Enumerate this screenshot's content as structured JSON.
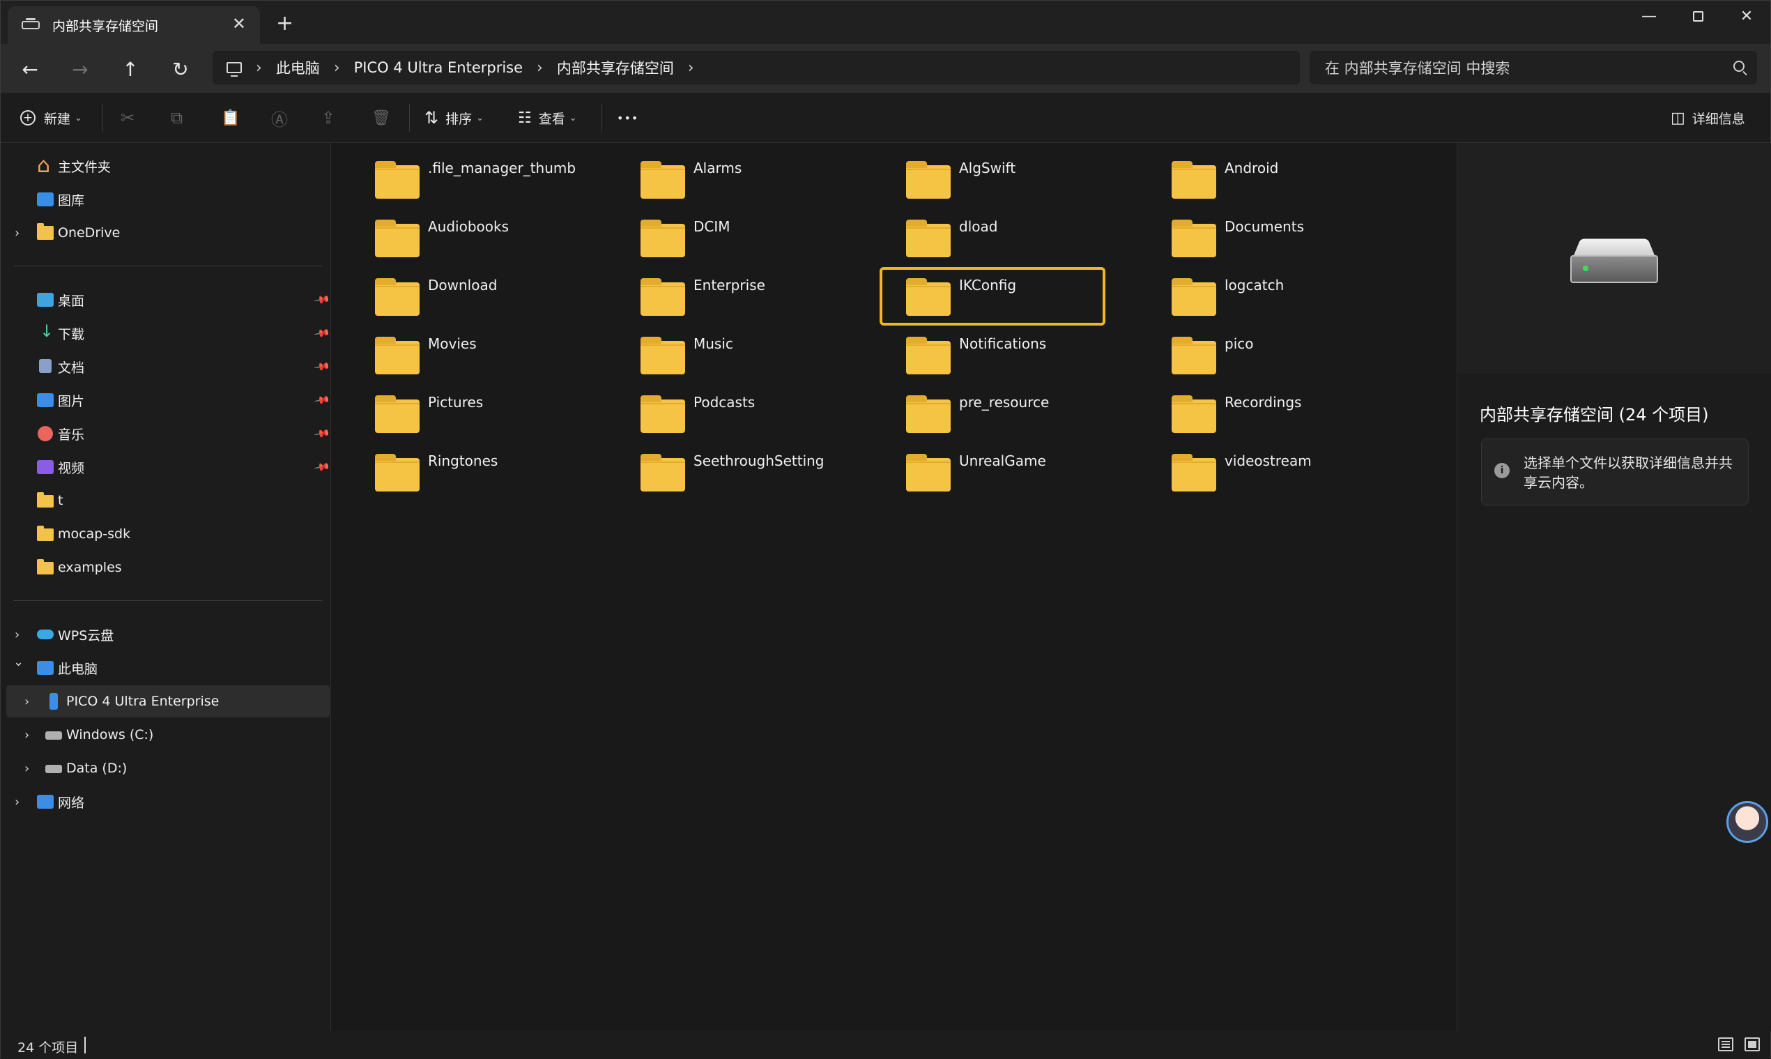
{
  "window": {
    "tab_title": "内部共享存储空间",
    "tab_close": "✕",
    "new_tab": "+",
    "min": "—",
    "close": "✕"
  },
  "nav": {
    "back": "←",
    "forward": "→",
    "up": "↑",
    "refresh": "↻",
    "breadcrumbs": [
      "此电脑",
      "PICO 4 Ultra Enterprise",
      "内部共享存储空间"
    ],
    "sep": "›",
    "search_placeholder": "在 内部共享存储空间 中搜索"
  },
  "toolbar": {
    "new_label": "新建",
    "sort_label": "排序",
    "view_label": "查看",
    "more": "•••",
    "details_label": "详细信息",
    "cut": "✂",
    "copy": "⧉",
    "paste": "📋",
    "rename": "Ⓐ",
    "share": "⇪",
    "delete": "🗑"
  },
  "sidebar": {
    "quick": [
      {
        "label": "主文件夹"
      },
      {
        "label": "图库"
      },
      {
        "label": "OneDrive"
      }
    ],
    "pinned": [
      {
        "label": "桌面"
      },
      {
        "label": "下载"
      },
      {
        "label": "文档"
      },
      {
        "label": "图片"
      },
      {
        "label": "音乐"
      },
      {
        "label": "视频"
      },
      {
        "label": "t"
      },
      {
        "label": "mocap-sdk"
      },
      {
        "label": "examples"
      }
    ],
    "tree": [
      {
        "label": "WPS云盘"
      },
      {
        "label": "此电脑"
      },
      {
        "label": "PICO 4 Ultra Enterprise"
      },
      {
        "label": "Windows (C:)"
      },
      {
        "label": "Data (D:)"
      },
      {
        "label": "网络"
      }
    ],
    "chev_right": "›",
    "chev_down": "⌄",
    "pin": "📌"
  },
  "files": [
    ".file_manager_thumb",
    "Alarms",
    "AlgSwift",
    "Android",
    "Audiobooks",
    "DCIM",
    "dload",
    "Documents",
    "Download",
    "Enterprise",
    "IKConfig",
    "logcatch",
    "Movies",
    "Music",
    "Notifications",
    "pico",
    "Pictures",
    "Podcasts",
    "pre_resource",
    "Recordings",
    "Ringtones",
    "SeethroughSetting",
    "UnrealGame",
    "videostream"
  ],
  "highlighted_file": "IKConfig",
  "details": {
    "title": "内部共享存储空间 (24 个项目)",
    "info": "选择单个文件以获取详细信息并共享云内容。",
    "info_icon": "i"
  },
  "status": {
    "count": "24 个项目"
  },
  "colors": {
    "accent_highlight": "#f2b61f",
    "folder": "#f6c445"
  }
}
